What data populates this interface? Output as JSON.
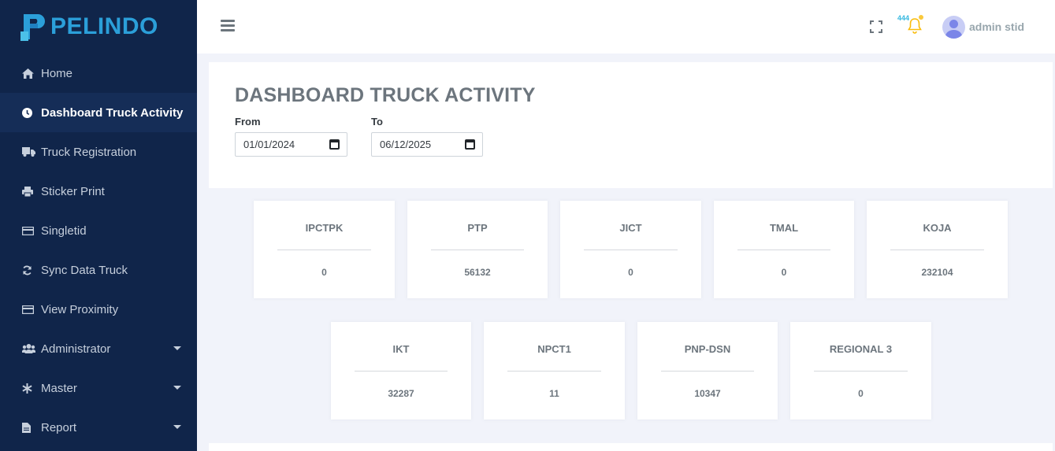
{
  "brand": {
    "name": "PELINDO",
    "color": "#2b9fd9"
  },
  "sidebar": {
    "items": [
      {
        "label": "Home",
        "icon": "home-icon"
      },
      {
        "label": "Dashboard Truck Activity",
        "icon": "clock-icon",
        "active": true
      },
      {
        "label": "Truck Registration",
        "icon": "truck-icon"
      },
      {
        "label": "Sticker Print",
        "icon": "printer-icon"
      },
      {
        "label": "Singletid",
        "icon": "credit-card-icon"
      },
      {
        "label": "Sync Data Truck",
        "icon": "sync-icon"
      },
      {
        "label": "View Proximity",
        "icon": "credit-card-icon"
      },
      {
        "label": "Administrator",
        "icon": "users-icon",
        "has_submenu": true
      },
      {
        "label": "Master",
        "icon": "asterisk-icon",
        "has_submenu": true
      },
      {
        "label": "Report",
        "icon": "file-icon",
        "has_submenu": true
      }
    ]
  },
  "topbar": {
    "notification_count": "444",
    "user_name": "admin stid"
  },
  "header": {
    "title": "DASHBOARD TRUCK ACTIVITY",
    "from_label": "From",
    "from_value": "01/01/2024",
    "to_label": "To",
    "to_value": "06/12/2025"
  },
  "stats": [
    {
      "label": "IPCTPK",
      "value": "0"
    },
    {
      "label": "PTP",
      "value": "56132"
    },
    {
      "label": "JICT",
      "value": "0"
    },
    {
      "label": "TMAL",
      "value": "0"
    },
    {
      "label": "KOJA",
      "value": "232104"
    },
    {
      "label": "IKT",
      "value": "32287"
    },
    {
      "label": "NPCT1",
      "value": "11"
    },
    {
      "label": "PNP-DSN",
      "value": "10347"
    },
    {
      "label": "REGIONAL 3",
      "value": "0"
    }
  ]
}
